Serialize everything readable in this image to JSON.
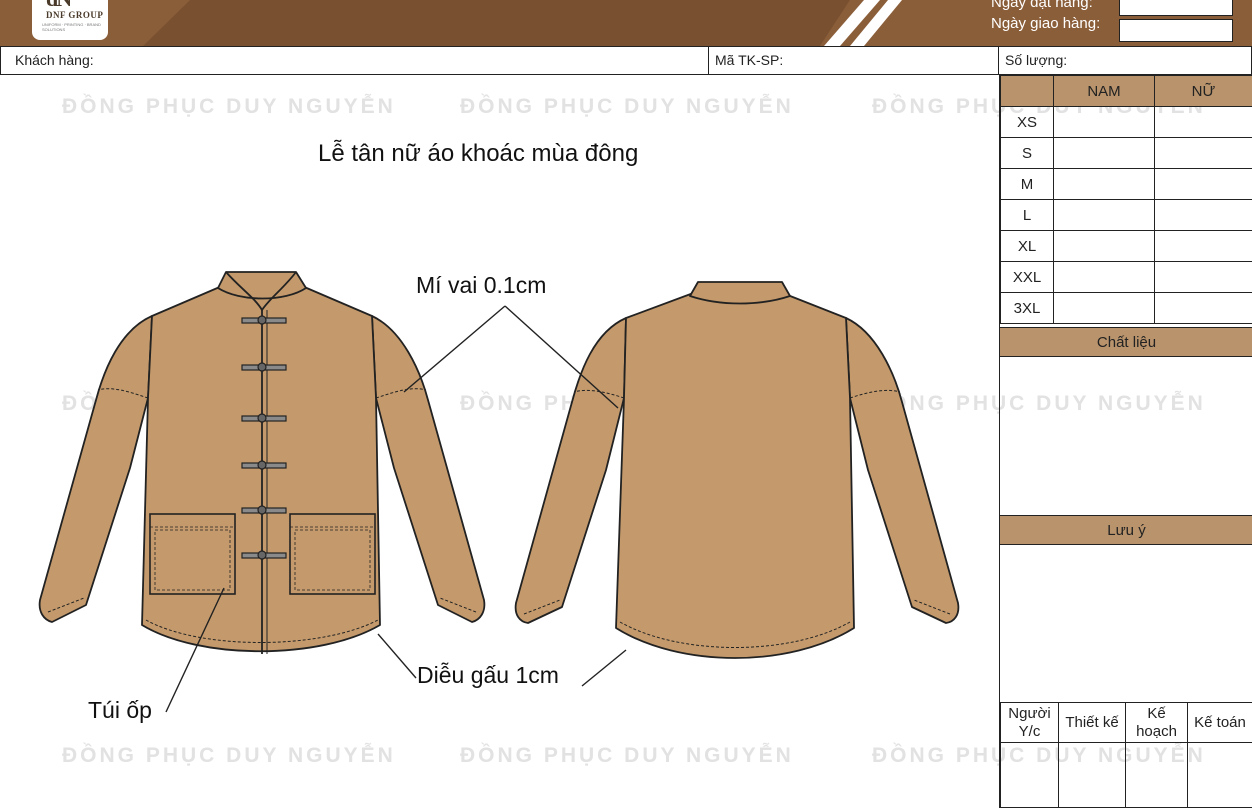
{
  "header": {
    "logo_mark": "dN",
    "logo_text": "DNF GROUP",
    "logo_sub": "UNIFORM · PRINTING · BRAND SOLUTIONS",
    "order_date_label": "Ngày đặt hàng:",
    "delivery_date_label": "Ngày giao hàng:",
    "order_date_value": "",
    "delivery_date_value": ""
  },
  "info": {
    "customer_label": "Khách hàng:",
    "product_code_label": "Mã TK-SP:",
    "quantity_label": "Số lượng:"
  },
  "watermark": "ĐỒNG PHỤC DUY NGUYỄN",
  "title": "Lễ tân nữ áo khoác mùa đông",
  "annotations": {
    "shoulder": "Mí vai 0.1cm",
    "hem": "Diễu gấu 1cm",
    "pocket": "Túi ốp"
  },
  "size_table": {
    "columns": [
      "NAM",
      "NỮ"
    ],
    "sizes": [
      "XS",
      "S",
      "M",
      "L",
      "XL",
      "XXL",
      "3XL"
    ]
  },
  "sections": {
    "material": "Chất liệu",
    "notes": "Lưu ý"
  },
  "signatures": {
    "requester": "Người Y/c",
    "designer": "Thiết kế",
    "planning": "Kế hoạch",
    "accounting": "Kế toán"
  },
  "colors": {
    "header_brown": "#8b5e3a",
    "band_tan": "#b8936c",
    "garment": "#c49a6c"
  }
}
